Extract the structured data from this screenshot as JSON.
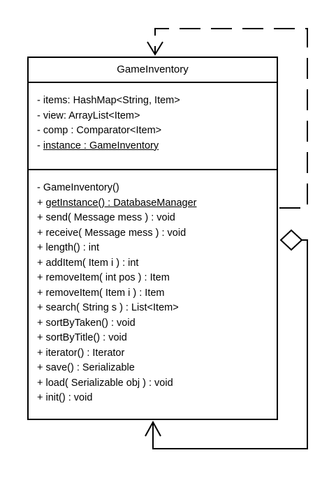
{
  "class": {
    "name": "GameInventory",
    "attributes": [
      {
        "vis": "-",
        "text": "items: HashMap<String, Item>",
        "static": false
      },
      {
        "vis": "-",
        "text": "view: ArrayList<Item>",
        "static": false
      },
      {
        "vis": "-",
        "text": "comp : Comparator<Item>",
        "static": false
      },
      {
        "vis": "-",
        "text": "instance : GameInventory",
        "static": true
      }
    ],
    "operations": [
      {
        "vis": "-",
        "text": "GameInventory()",
        "static": false
      },
      {
        "vis": "+",
        "text": "getInstance() : DatabaseManager",
        "static": true
      },
      {
        "vis": "+",
        "text": "send( Message mess ) : void",
        "static": false
      },
      {
        "vis": "+",
        "text": "receive( Message mess ) : void",
        "static": false
      },
      {
        "vis": "+",
        "text": "length() : int",
        "static": false
      },
      {
        "vis": "+",
        "text": "addItem( Item i ) : int",
        "static": false
      },
      {
        "vis": "+",
        "text": "removeItem( int pos ) : Item",
        "static": false
      },
      {
        "vis": "+",
        "text": "removeItem( Item i ) : Item",
        "static": false
      },
      {
        "vis": "+",
        "text": "search( String s ) : List<Item>",
        "static": false
      },
      {
        "vis": "+",
        "text": "sortByTaken() : void",
        "static": false
      },
      {
        "vis": "+",
        "text": "sortByTitle() : void",
        "static": false
      },
      {
        "vis": "+",
        "text": "iterator() : Iterator",
        "static": false
      },
      {
        "vis": "+",
        "text": "save() : Serializable",
        "static": false
      },
      {
        "vis": "+",
        "text": "load( Serializable obj ) : void",
        "static": false
      },
      {
        "vis": "+",
        "text": "init() : void",
        "static": false
      }
    ]
  },
  "relationships": [
    {
      "type": "dependency",
      "from": "GameInventory",
      "to": "GameInventory",
      "line": "dashed",
      "head": "open-arrow"
    },
    {
      "type": "aggregation",
      "from": "GameInventory",
      "to": "GameInventory",
      "line": "solid",
      "head": "open-arrow",
      "tail": "hollow-diamond"
    }
  ],
  "colors": {
    "line": "#000000",
    "background": "#ffffff"
  }
}
